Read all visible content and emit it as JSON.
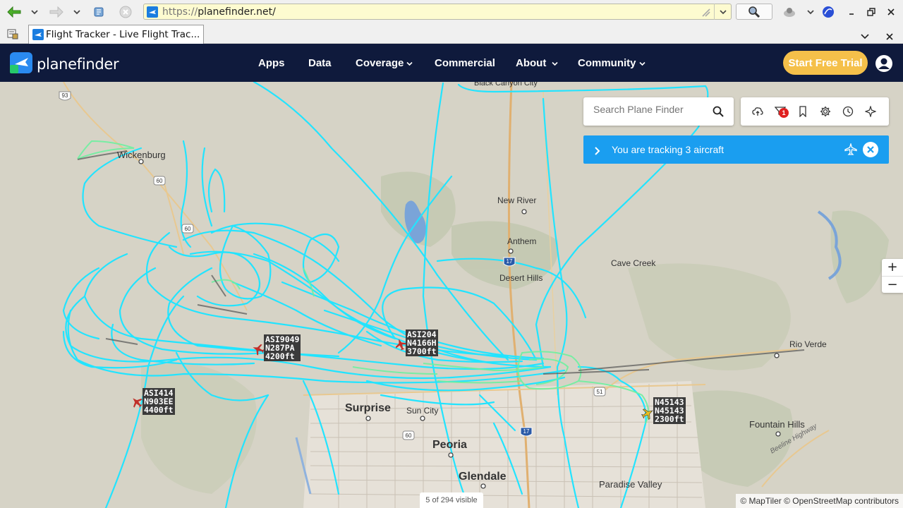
{
  "browser": {
    "url_protocol": "https://",
    "url_host": "planefinder.net/",
    "tab_title": "Flight Tracker - Live Flight Trac...",
    "icons": [
      "back-arrow-icon",
      "forward-arrow-icon",
      "history-icon",
      "stop-icon",
      "search-magnifier-icon",
      "close-icon"
    ]
  },
  "header": {
    "logo_text": "planefinder",
    "nav": [
      {
        "label": "Apps"
      },
      {
        "label": "Data"
      },
      {
        "label": "Coverage"
      },
      {
        "label": "Commercial"
      },
      {
        "label": "About"
      },
      {
        "label": "Community"
      }
    ],
    "cta_label": "Start Free Trial",
    "colors": {
      "header_bg": "#0f1a3c",
      "cta": "#f5c04a",
      "track": "#22e4ff",
      "tracking_bar": "#1a9ef0"
    }
  },
  "search": {
    "placeholder": "Search Plane Finder"
  },
  "tools": {
    "notification_count": "1"
  },
  "tracking": {
    "text": "You are tracking 3 aircraft"
  },
  "zoom": {
    "in": "+",
    "out": "−"
  },
  "map": {
    "places": [
      {
        "name": "Wickenburg"
      },
      {
        "name": "New River"
      },
      {
        "name": "Anthem"
      },
      {
        "name": "Cave Creek"
      },
      {
        "name": "Desert Hills"
      },
      {
        "name": "Rio Verde"
      },
      {
        "name": "Surprise"
      },
      {
        "name": "Sun City"
      },
      {
        "name": "Peoria"
      },
      {
        "name": "Glendale"
      },
      {
        "name": "Fountain Hills"
      },
      {
        "name": "Paradise Valley"
      },
      {
        "name": "Black Canyon City"
      },
      {
        "name": "Beeline Highway"
      }
    ],
    "shields": [
      "93",
      "60",
      "60",
      "17",
      "51",
      "17",
      "60"
    ],
    "aircraft": [
      {
        "callsign": "ASI9049",
        "reg": "N287PA",
        "alt": "4200ft"
      },
      {
        "callsign": "ASI204",
        "reg": "N4166H",
        "alt": "3700ft"
      },
      {
        "callsign": "ASI414",
        "reg": "N903EE",
        "alt": "4400ft"
      },
      {
        "callsign": "N45143",
        "reg": "N45143",
        "alt": "2300ft"
      }
    ],
    "visible_count": "5 of 294 visible",
    "attribution": "© MapTiler © OpenStreetMap contributors"
  }
}
